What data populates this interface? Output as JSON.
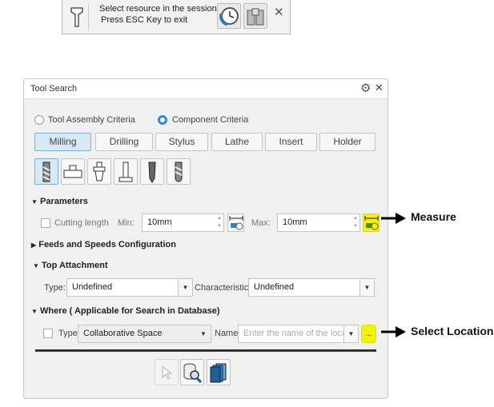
{
  "toolbar": {
    "line1": "Select resource in the session",
    "line2": "Press ESC Key to exit",
    "icons": [
      "tool-holder-icon",
      "history-clock-icon",
      "binoculars-icon",
      "close-icon"
    ],
    "close": "✕"
  },
  "dialog": {
    "title": "Tool Search",
    "gear": "⚙",
    "close": "✕",
    "criteria": [
      {
        "label": "Tool Assembly Criteria",
        "selected": false
      },
      {
        "label": "Component Criteria",
        "selected": true
      }
    ],
    "tabs": [
      {
        "label": "Milling",
        "selected": true
      },
      {
        "label": "Drilling"
      },
      {
        "label": "Stylus"
      },
      {
        "label": "Lathe"
      },
      {
        "label": "Insert"
      },
      {
        "label": "Holder"
      }
    ],
    "tool_types": [
      "end-mill-icon",
      "face-mill-icon",
      "t-slot-cutter-icon",
      "t-tool-icon",
      "drill-mill-icon",
      "ball-mill-icon"
    ],
    "parameters": {
      "header": "Parameters",
      "cutting_length_label": "Cutting length",
      "cutting_length_checked": false,
      "min_label": "Min:",
      "min_value": "10mm",
      "max_label": "Max:",
      "max_value": "10mm"
    },
    "feeds": {
      "header": "Feeds and Speeds Configuration",
      "expanded": false
    },
    "top_attachment": {
      "header": "Top Attachment",
      "type_label": "Type:",
      "type_value": "Undefined",
      "char_label": "Characteristic:",
      "char_value": "Undefined"
    },
    "where": {
      "header": "Where ( Applicable for Search in Database)",
      "type_label": "Type",
      "type_checked": false,
      "type_value": "Collaborative Space",
      "name_label": "Name",
      "name_placeholder": "Enter the name of the loca",
      "browse_label": "..."
    },
    "bottom_buttons": [
      "select-pointer-icon",
      "database-search-icon",
      "catalog-books-icon"
    ]
  },
  "annotations": {
    "measure": "Measure",
    "select_location": "Select Location",
    "highlight_color": "#f3f300"
  },
  "glyphs": {
    "expanded": "▼",
    "collapsed": "▶",
    "dropdown": "▼"
  }
}
